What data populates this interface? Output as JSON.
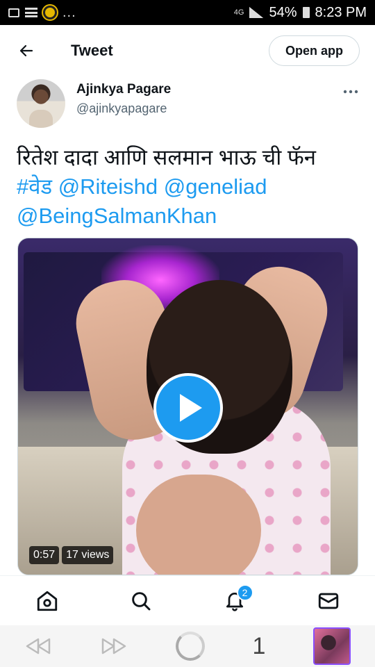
{
  "status_bar": {
    "network": "4G",
    "battery": "54%",
    "time": "8:23 PM",
    "dots": "..."
  },
  "header": {
    "title": "Tweet",
    "open_app": "Open app"
  },
  "tweet": {
    "author_name": "Ajinkya Pagare",
    "author_handle": "@ajinkyapagare",
    "text_plain": "रितेश दादा आणि सलमान भाऊ ची फॅन",
    "hashtag": "#वेड",
    "mention1": "@Riteishd",
    "mention2": "@geneliad",
    "mention3": "@BeingSalmanKhan"
  },
  "video": {
    "duration": "0:57",
    "views": "17 views"
  },
  "bottom_nav": {
    "notifications_count": "2"
  },
  "browser": {
    "tab_count": "1"
  },
  "colors": {
    "accent": "#1d9bf0",
    "text": "#0f1419",
    "muted": "#536471"
  }
}
